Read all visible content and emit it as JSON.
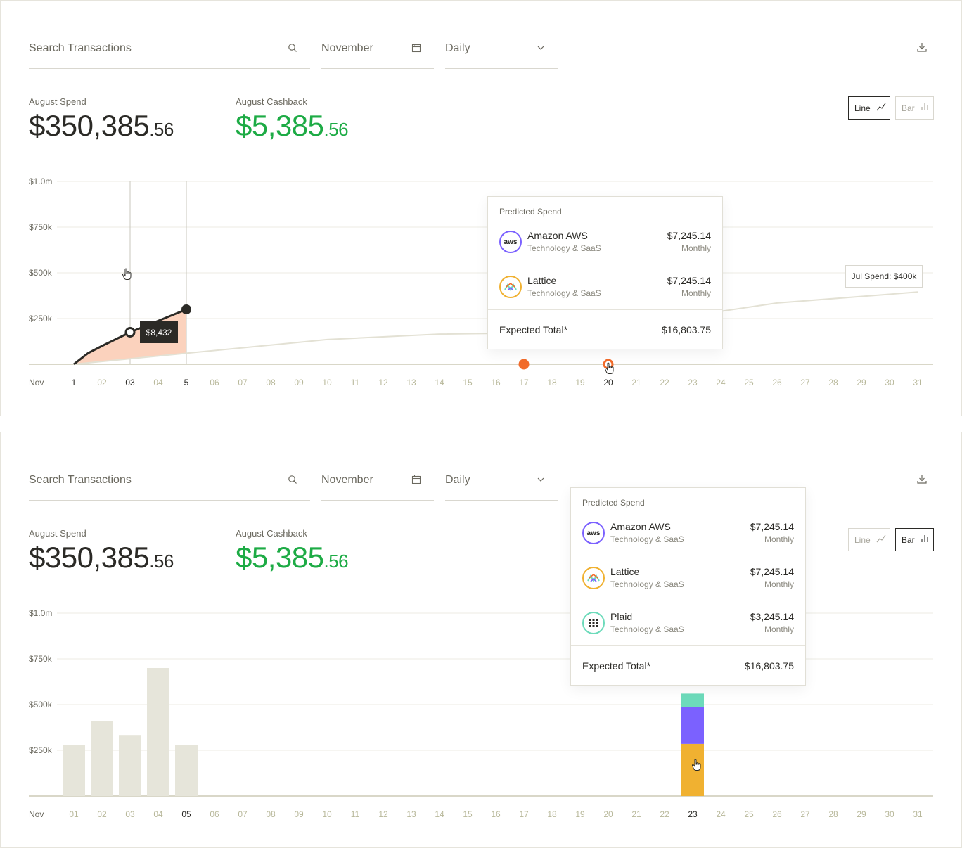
{
  "search": {
    "placeholder": "Search Transactions"
  },
  "month_filter": {
    "value": "November"
  },
  "period_filter": {
    "value": "Daily"
  },
  "stats": {
    "spend_label": "August Spend",
    "spend_whole": "$350,385",
    "spend_cents": ".56",
    "cashback_label": "August Cashback",
    "cashback_whole": "$5,385",
    "cashback_cents": ".56"
  },
  "view_toggle": {
    "line_label": "Line",
    "bar_label": "Bar"
  },
  "colors": {
    "accent_orange": "#f26b2a",
    "area_fill": "#fbd2bd",
    "cashback_green": "#1dab45",
    "prior_line": "#e3e1d4",
    "bar_neutral": "#e6e5da",
    "aws_purple": "#7b61ff",
    "lattice_orange": "#f0b131",
    "plaid_teal": "#6ddbbb"
  },
  "predicted_card_1": {
    "title": "Predicted Spend",
    "items": [
      {
        "name": "Amazon AWS",
        "category": "Technology & SaaS",
        "amount": "$7,245.14",
        "frequency": "Monthly",
        "icon": "aws-logo-icon"
      },
      {
        "name": "Lattice",
        "category": "Technology & SaaS",
        "amount": "$7,245.14",
        "frequency": "Monthly",
        "icon": "lattice-logo-icon"
      }
    ],
    "total_label": "Expected Total*",
    "total_value": "$16,803.75"
  },
  "predicted_card_2": {
    "title": "Predicted Spend",
    "items": [
      {
        "name": "Amazon AWS",
        "category": "Technology & SaaS",
        "amount": "$7,245.14",
        "frequency": "Monthly",
        "icon": "aws-logo-icon"
      },
      {
        "name": "Lattice",
        "category": "Technology & SaaS",
        "amount": "$7,245.14",
        "frequency": "Monthly",
        "icon": "lattice-logo-icon"
      },
      {
        "name": "Plaid",
        "category": "Technology & SaaS",
        "amount": "$3,245.14",
        "frequency": "Monthly",
        "icon": "plaid-logo-icon"
      }
    ],
    "total_label": "Expected Total*",
    "total_value": "$16,803.75"
  },
  "line_tooltip": {
    "value": "$8,432"
  },
  "jul_tooltip": {
    "value": "Jul Spend: $400k"
  },
  "chart_data": [
    {
      "type": "line",
      "y_ticks": [
        "$1.0m",
        "$750k",
        "$500k",
        "$250k"
      ],
      "ylim": [
        0,
        1000000
      ],
      "month_label": "Nov",
      "x_ticks": [
        "1",
        "02",
        "03",
        "04",
        "5",
        "06",
        "07",
        "08",
        "09",
        "10",
        "11",
        "12",
        "13",
        "14",
        "15",
        "16",
        "17",
        "18",
        "19",
        "20",
        "21",
        "22",
        "23",
        "24",
        "25",
        "26",
        "27",
        "28",
        "29",
        "30",
        "31"
      ],
      "series": [
        {
          "values": [
            [
              1,
              0
            ],
            [
              1.5,
              60000
            ],
            [
              2,
              100000
            ],
            [
              3,
              175000
            ],
            [
              5,
              300000
            ]
          ]
        },
        {
          "values": [
            [
              1,
              0
            ],
            [
              5,
              60000
            ],
            [
              10,
              135000
            ],
            [
              14,
              165000
            ],
            [
              19,
              175000
            ],
            [
              26,
              335000
            ],
            [
              31,
              395000
            ]
          ]
        }
      ],
      "markers": [
        {
          "x": 3,
          "y": 175000,
          "style": "hollow"
        },
        {
          "x": 5,
          "y": 300000,
          "style": "filled"
        },
        {
          "x": 17,
          "y": 0,
          "style": "orange-filled"
        },
        {
          "x": 20,
          "y": 0,
          "style": "orange-hollow"
        }
      ],
      "grid": true
    },
    {
      "type": "bar",
      "y_ticks": [
        "$1.0m",
        "$750k",
        "$500k",
        "$250k"
      ],
      "ylim": [
        0,
        1000000
      ],
      "month_label": "Nov",
      "categories": [
        "01",
        "02",
        "03",
        "04",
        "05",
        "06",
        "07",
        "08",
        "09",
        "10",
        "11",
        "12",
        "13",
        "14",
        "15",
        "16",
        "17",
        "18",
        "19",
        "20",
        "21",
        "22",
        "23",
        "24",
        "25",
        "26",
        "27",
        "28",
        "29",
        "30",
        "31"
      ],
      "values": [
        280000,
        410000,
        330000,
        700000,
        280000,
        0,
        0,
        0,
        0,
        0,
        0,
        0,
        0,
        0,
        0,
        0,
        0,
        0,
        0,
        0,
        0,
        0,
        0,
        0,
        0,
        0,
        0,
        0,
        0,
        0,
        0
      ],
      "stacked_bar": {
        "category": "23",
        "segments": [
          {
            "name": "Lattice",
            "value": 285000,
            "color": "#f0b131"
          },
          {
            "name": "Amazon AWS",
            "value": 200000,
            "color": "#7b61ff"
          },
          {
            "name": "Plaid",
            "value": 75000,
            "color": "#6ddbbb"
          }
        ]
      },
      "grid": true
    }
  ]
}
